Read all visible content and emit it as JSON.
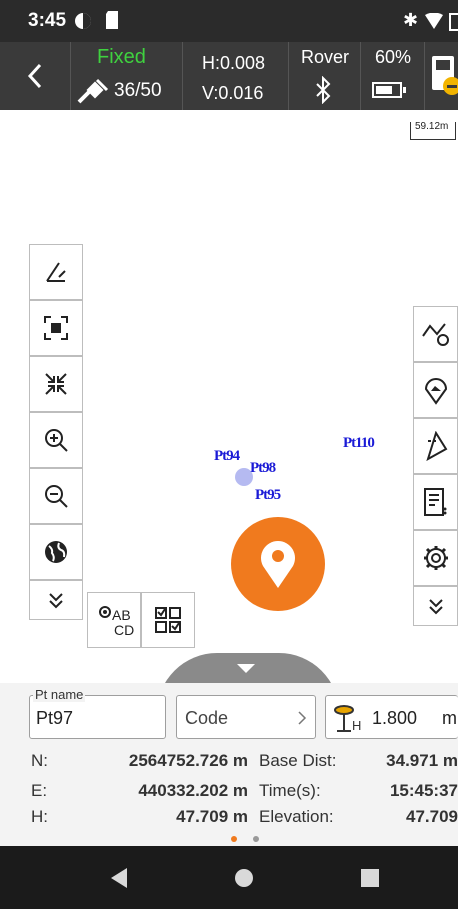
{
  "status": {
    "time": "3:45"
  },
  "topbar": {
    "fix_status": "Fixed",
    "satellites": "36/50",
    "h_precision": "H:0.008",
    "v_precision": "V:0.016",
    "mode": "Rover",
    "battery": "60%"
  },
  "map": {
    "scale_label": "59.12m",
    "point_labels": [
      {
        "text": "Pt110"
      },
      {
        "text": "Pt98"
      },
      {
        "text": "Pt94"
      },
      {
        "text": "Pt95"
      }
    ],
    "ab_cd_top": "AB",
    "ab_cd_bottom": "CD"
  },
  "panel": {
    "pt_name_label": "Pt name",
    "pt_name_value": "Pt97",
    "code_placeholder": "Code",
    "antenna_height": "1.800",
    "antenna_unit": "m",
    "antenna_sub": "H",
    "rows": [
      {
        "label": "N:",
        "value": "2564752.726 m",
        "label2": "Base Dist:",
        "value2": "34.971 m"
      },
      {
        "label": "E:",
        "value": "440332.202 m",
        "label2": "Time(s):",
        "value2": "15:45:37"
      },
      {
        "label": "H:",
        "value": "47.709 m",
        "label2": "Elevation:",
        "value2": "47.709"
      }
    ]
  },
  "colors": {
    "fixed_green": "#3fd13f",
    "accent_orange": "#f07a1e",
    "point_blue": "#1a1ad6"
  }
}
